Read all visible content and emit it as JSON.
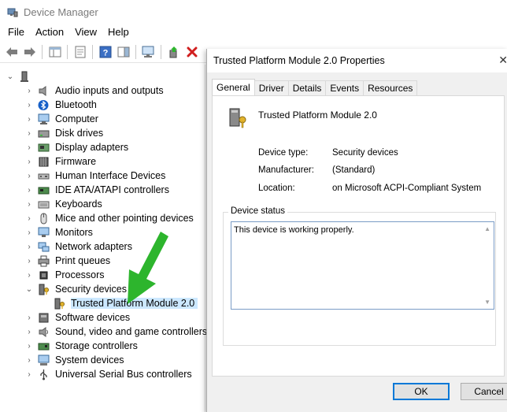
{
  "window": {
    "title": "Device Manager"
  },
  "menu": [
    "File",
    "Action",
    "View",
    "Help"
  ],
  "tree": {
    "items": [
      {
        "label": "Audio inputs and outputs",
        "icon": "speaker-icon",
        "expanded": false
      },
      {
        "label": "Bluetooth",
        "icon": "bluetooth-icon",
        "expanded": false
      },
      {
        "label": "Computer",
        "icon": "computer-icon",
        "expanded": false
      },
      {
        "label": "Disk drives",
        "icon": "disk-drive-icon",
        "expanded": false
      },
      {
        "label": "Display adapters",
        "icon": "display-adapter-icon",
        "expanded": false
      },
      {
        "label": "Firmware",
        "icon": "firmware-icon",
        "expanded": false
      },
      {
        "label": "Human Interface Devices",
        "icon": "hid-icon",
        "expanded": false
      },
      {
        "label": "IDE ATA/ATAPI controllers",
        "icon": "ide-controller-icon",
        "expanded": false
      },
      {
        "label": "Keyboards",
        "icon": "keyboard-icon",
        "expanded": false
      },
      {
        "label": "Mice and other pointing devices",
        "icon": "mouse-icon",
        "expanded": false
      },
      {
        "label": "Monitors",
        "icon": "monitor-icon",
        "expanded": false
      },
      {
        "label": "Network adapters",
        "icon": "network-adapter-icon",
        "expanded": false
      },
      {
        "label": "Print queues",
        "icon": "printer-icon",
        "expanded": false
      },
      {
        "label": "Processors",
        "icon": "processor-icon",
        "expanded": false
      },
      {
        "label": "Security devices",
        "icon": "security-device-icon",
        "expanded": true
      },
      {
        "label": "Trusted Platform Module 2.0",
        "icon": "tpm-key-icon",
        "child": true,
        "selected": true
      },
      {
        "label": "Software devices",
        "icon": "software-device-icon",
        "expanded": false
      },
      {
        "label": "Sound, video and game controllers",
        "icon": "sound-controller-icon",
        "expanded": false
      },
      {
        "label": "Storage controllers",
        "icon": "storage-controller-icon",
        "expanded": false
      },
      {
        "label": "System devices",
        "icon": "system-device-icon",
        "expanded": false
      },
      {
        "label": "Universal Serial Bus controllers",
        "icon": "usb-icon",
        "expanded": false
      }
    ]
  },
  "dialog": {
    "title": "Trusted Platform Module 2.0 Properties",
    "close_glyph": "✕",
    "tabs": [
      "General",
      "Driver",
      "Details",
      "Events",
      "Resources"
    ],
    "active_tab": "General",
    "device_name": "Trusted Platform Module 2.0",
    "properties": [
      {
        "label": "Device type:",
        "value": "Security devices"
      },
      {
        "label": "Manufacturer:",
        "value": "(Standard)"
      },
      {
        "label": "Location:",
        "value": "on Microsoft ACPI-Compliant System"
      }
    ],
    "status_legend": "Device status",
    "status_text": "This device is working properly.",
    "ok_label": "OK",
    "cancel_label": "Cancel"
  },
  "colors": {
    "selection": "#cce8ff",
    "arrow": "#2db52d",
    "focus": "#0078d7",
    "delete_red": "#d11f1f"
  }
}
